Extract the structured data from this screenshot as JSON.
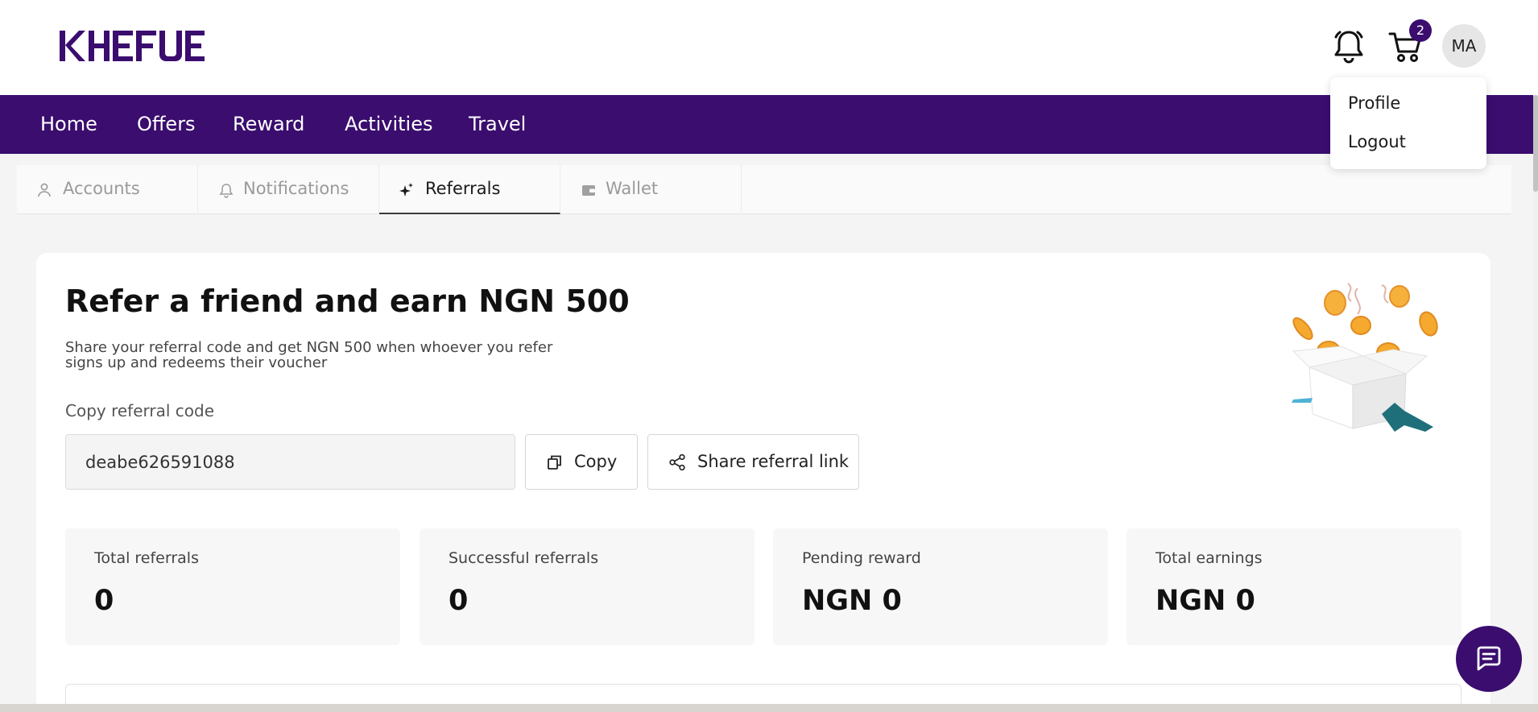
{
  "brand": {
    "logo_text": "KHEFUE",
    "color": "#3a0d6e"
  },
  "header": {
    "notification_icon": "bell-icon",
    "cart_icon": "cart-icon",
    "cart_count": "2",
    "avatar_initials": "MA"
  },
  "nav": {
    "items": [
      "Home",
      "Offers",
      "Reward",
      "Activities",
      "Travel"
    ]
  },
  "profile_menu": {
    "items": [
      "Profile",
      "Logout"
    ]
  },
  "tabs": [
    {
      "label": "Accounts",
      "icon": "user-icon"
    },
    {
      "label": "Notifications",
      "icon": "bell-icon"
    },
    {
      "label": "Referrals",
      "icon": "sparkle-icon",
      "active": true
    },
    {
      "label": "Wallet",
      "icon": "wallet-icon"
    }
  ],
  "referral": {
    "title": "Refer a friend and earn NGN 500",
    "subtitle": "Share your referral code and get NGN 500 when whoever you refer signs up and redeems their voucher",
    "copy_label": "Copy referral code",
    "code": "deabe626591088",
    "copy_button": "Copy",
    "share_button": "Share referral link"
  },
  "stats": [
    {
      "label": "Total referrals",
      "value": "0"
    },
    {
      "label": "Successful referrals",
      "value": "0"
    },
    {
      "label": "Pending reward",
      "value": "NGN 0"
    },
    {
      "label": "Total earnings",
      "value": "NGN 0"
    }
  ],
  "chat": {
    "icon": "chat-icon"
  }
}
